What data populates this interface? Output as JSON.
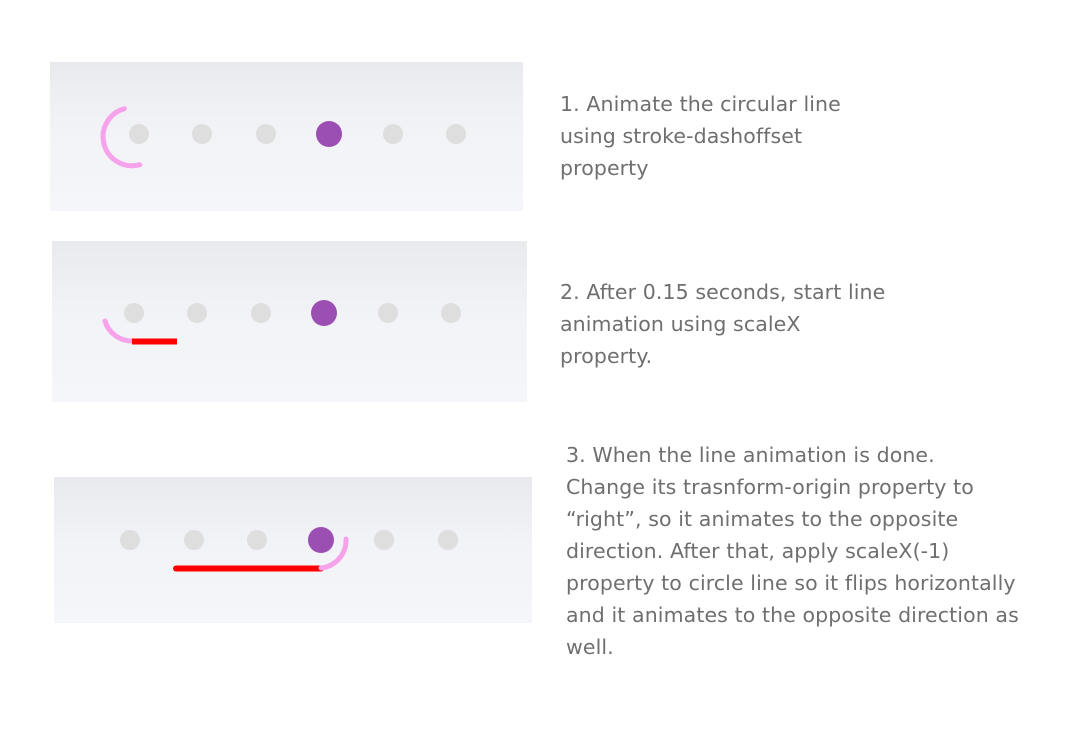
{
  "steps": [
    {
      "lines": [
        "1. Animate the circular line",
        "using stroke-dashoffset",
        "property"
      ],
      "active_dot": 4
    },
    {
      "lines": [
        "2. After 0.15 seconds, start line",
        "animation using scaleX",
        "property."
      ],
      "active_dot": 4
    },
    {
      "lines": [
        "3. When the line animation is done.",
        "Change its trasnform-origin property to",
        "“right”, so it animates to the opposite",
        "direction. After that, apply scaleX(-1)",
        "property to circle line so it flips horizontally",
        "and it animates to the opposite direction as",
        "well."
      ],
      "active_dot": 4
    }
  ],
  "colors": {
    "dot_inactive": "#dedede",
    "dot_active": "#9c4fb3",
    "circular_line": "#f6a3ec",
    "straight_line": "#ff0000",
    "caption_text": "#6f6f6f"
  }
}
